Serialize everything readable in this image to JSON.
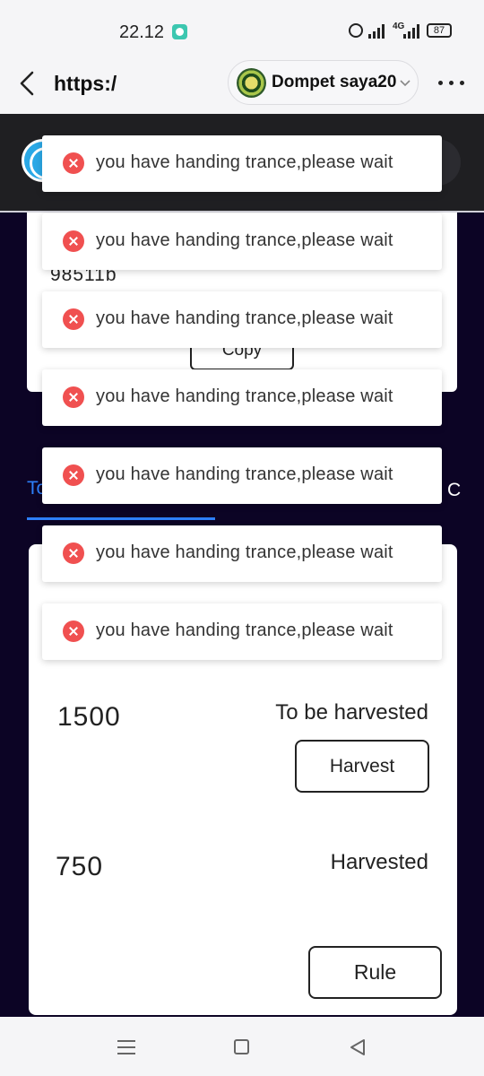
{
  "status_bar": {
    "time": "22.12",
    "network": "4G",
    "battery": "87",
    "icons": [
      "chat-app-icon",
      "alarm-icon",
      "signal-icon",
      "signal-icon",
      "battery-icon"
    ]
  },
  "browser": {
    "url": "https:/",
    "wallet_name": "Dompet saya20",
    "icons": [
      "back-icon",
      "chevron-down-icon",
      "more-icon"
    ]
  },
  "address_card": {
    "address_fragment": "98511b",
    "copy_label": "Copy"
  },
  "tabs": {
    "left_label": "To",
    "right_label": "C"
  },
  "harvest": {
    "to_be_value": "1500",
    "to_be_label": "To be harvested",
    "harvest_button": "Harvest",
    "harvested_value": "750",
    "harvested_label": "Harvested",
    "rule_button": "Rule"
  },
  "toasts": [
    {
      "message": "you have handing trance,please wait"
    },
    {
      "message": "you have handing trance,please wait"
    },
    {
      "message": "you have handing trance,please wait"
    },
    {
      "message": "you have handing trance,please wait"
    },
    {
      "message": "you have handing trance,please wait"
    },
    {
      "message": "you have handing trance,please wait"
    },
    {
      "message": "you have handing trance,please wait"
    }
  ],
  "colors": {
    "accent": "#2d7ff9",
    "page_background": "#0c0425",
    "error": "#f05050"
  },
  "nav_icons": [
    "menu-icon",
    "home-icon",
    "back-triangle-icon"
  ]
}
